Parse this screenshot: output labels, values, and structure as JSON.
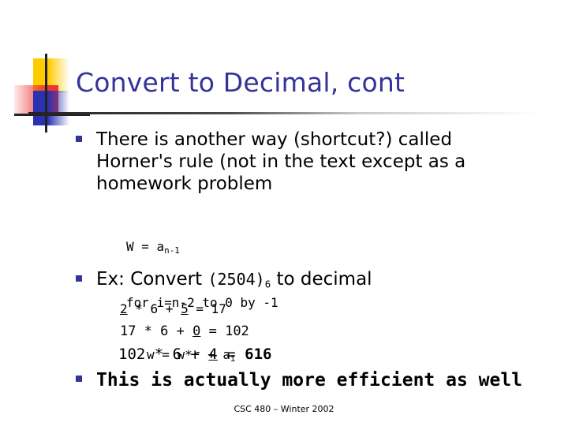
{
  "slide": {
    "title": "Convert to Decimal, cont",
    "title_color": "#333399",
    "bullet_color": "#333399",
    "background": "#ffffff",
    "footer": "CSC 480 – Winter 2002"
  },
  "bullets": [
    {
      "id": "bullet-1",
      "text": "There is another way (shortcut?) called Horner's rule (not in the text except as a homework problem",
      "style": "normal"
    },
    {
      "id": "bullet-2",
      "prefix": "Ex: Convert ",
      "mono": "(2504)",
      "subscript": "6",
      "suffix": " to decimal",
      "style": "normal"
    },
    {
      "id": "bullet-3",
      "text": "This is actually more efficient as well",
      "style": "bold-mono"
    }
  ],
  "code_block": {
    "lines": [
      {
        "indent": 1,
        "text": "W = a",
        "sub": "n-1",
        "tail": ""
      },
      {
        "indent": 1,
        "text": "for i=n-2 to 0 by -1",
        "sub": "",
        "tail": ""
      },
      {
        "indent": 2,
        "text": "w = w*r + a",
        "sub": "i",
        "tail": ""
      }
    ]
  },
  "calculations": [
    {
      "id": "calc-1",
      "parts": [
        {
          "t": "2",
          "underline": true,
          "bold": false
        },
        {
          "t": " * 6 + ",
          "underline": false,
          "bold": false
        },
        {
          "t": "5",
          "underline": true,
          "bold": false
        },
        {
          "t": " = 17",
          "underline": false,
          "bold": false
        }
      ],
      "plain": "2 * 6 + 5 = 17"
    },
    {
      "id": "calc-2",
      "parts": [
        {
          "t": "17 * 6 + ",
          "underline": false,
          "bold": false
        },
        {
          "t": "0",
          "underline": true,
          "bold": false
        },
        {
          "t": " = 102",
          "underline": false,
          "bold": false
        }
      ],
      "plain": "17 * 6 + 0 = 102"
    },
    {
      "id": "calc-3",
      "parts": [
        {
          "t": "102 * 6 + ",
          "underline": false,
          "bold": false
        },
        {
          "t": "4",
          "underline": true,
          "bold": false
        },
        {
          "t": " = ",
          "underline": false,
          "bold": false
        },
        {
          "t": "616",
          "underline": false,
          "bold": true
        }
      ],
      "plain": "102 * 6 + 4 = 616"
    }
  ],
  "decoration": {
    "yellow": "#FFCC00",
    "red": "#EE3333",
    "blue": "#2B32B2",
    "cross": "#222222"
  }
}
